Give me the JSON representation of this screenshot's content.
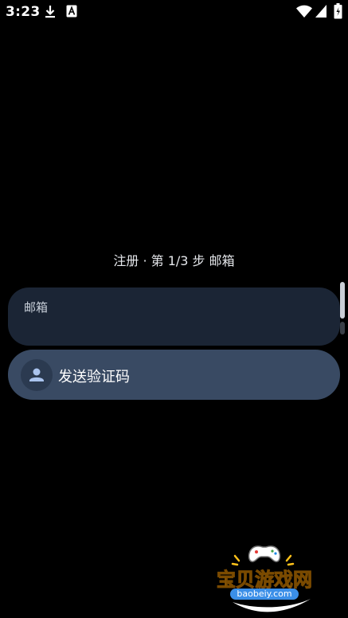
{
  "status_bar": {
    "time": "3:23",
    "icons": [
      "download-icon",
      "font-a-icon",
      "wifi-icon",
      "cell-signal-icon",
      "battery-icon"
    ]
  },
  "registration": {
    "step_title": "注册 · 第 1/3 步 邮箱",
    "email_label": "邮箱",
    "email_value": "",
    "send_code_label": "发送验证码"
  },
  "watermark": {
    "title": "宝贝游戏网",
    "url": "baobeiy.com"
  },
  "colors": {
    "background": "#000000",
    "input_bg": "#1b2535",
    "button_bg": "#394a63",
    "watermark_yellow": "#ffd23a",
    "watermark_blue": "#3b8fe8"
  }
}
